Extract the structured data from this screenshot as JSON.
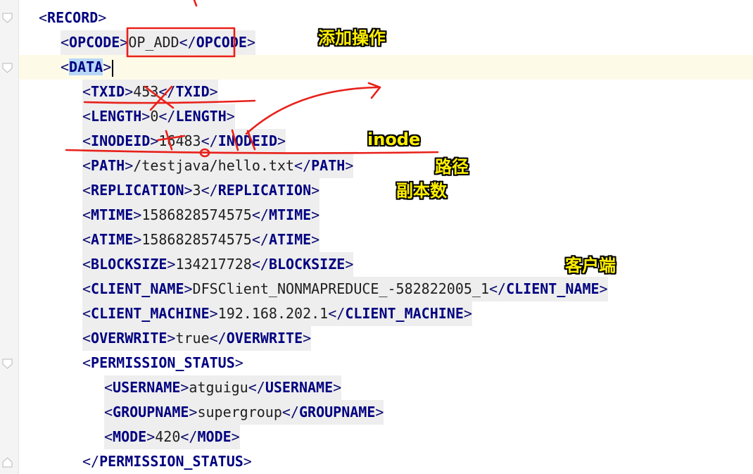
{
  "editor": {
    "lines": [
      {
        "tag": "RECORD",
        "type": "open",
        "indent": 0,
        "fold": true
      },
      {
        "tag": "OPCODE",
        "type": "full",
        "value": "OP_ADD",
        "indent": 1
      },
      {
        "tag": "DATA",
        "type": "open",
        "indent": 1,
        "fold": true,
        "selected": true,
        "caret": true
      },
      {
        "tag": "TXID",
        "type": "full",
        "value": "453",
        "indent": 2
      },
      {
        "tag": "LENGTH",
        "type": "full",
        "value": "0",
        "indent": 2
      },
      {
        "tag": "INODEID",
        "type": "full",
        "value": "16483",
        "indent": 2
      },
      {
        "tag": "PATH",
        "type": "full",
        "value": "/testjava/hello.txt",
        "indent": 2
      },
      {
        "tag": "REPLICATION",
        "type": "full",
        "value": "3",
        "indent": 2
      },
      {
        "tag": "MTIME",
        "type": "full",
        "value": "1586828574575",
        "indent": 2
      },
      {
        "tag": "ATIME",
        "type": "full",
        "value": "1586828574575",
        "indent": 2
      },
      {
        "tag": "BLOCKSIZE",
        "type": "full",
        "value": "134217728",
        "indent": 2
      },
      {
        "tag": "CLIENT_NAME",
        "type": "full",
        "value": "DFSClient_NONMAPREDUCE_-582822005_1",
        "indent": 2
      },
      {
        "tag": "CLIENT_MACHINE",
        "type": "full",
        "value": "192.168.202.1",
        "indent": 2
      },
      {
        "tag": "OVERWRITE",
        "type": "full",
        "value": "true",
        "indent": 2
      },
      {
        "tag": "PERMISSION_STATUS",
        "type": "open",
        "indent": 2,
        "fold": true
      },
      {
        "tag": "USERNAME",
        "type": "full",
        "value": "atguigu",
        "indent": 3
      },
      {
        "tag": "GROUPNAME",
        "type": "full",
        "value": "supergroup",
        "indent": 3
      },
      {
        "tag": "MODE",
        "type": "full",
        "value": "420",
        "indent": 3
      },
      {
        "tag": "PERMISSION_STATUS",
        "type": "close",
        "indent": 2
      }
    ]
  },
  "annotations": {
    "add_op": "添加操作",
    "inode": "inode",
    "path": "路径",
    "replication": "副本数",
    "client": "客户端"
  },
  "colors": {
    "tag_name": "#000080",
    "annotation_text": "#ffef00",
    "pen": "#e8201a",
    "selection": "#b7d7f6",
    "caret_line": "#fdfbe8"
  }
}
